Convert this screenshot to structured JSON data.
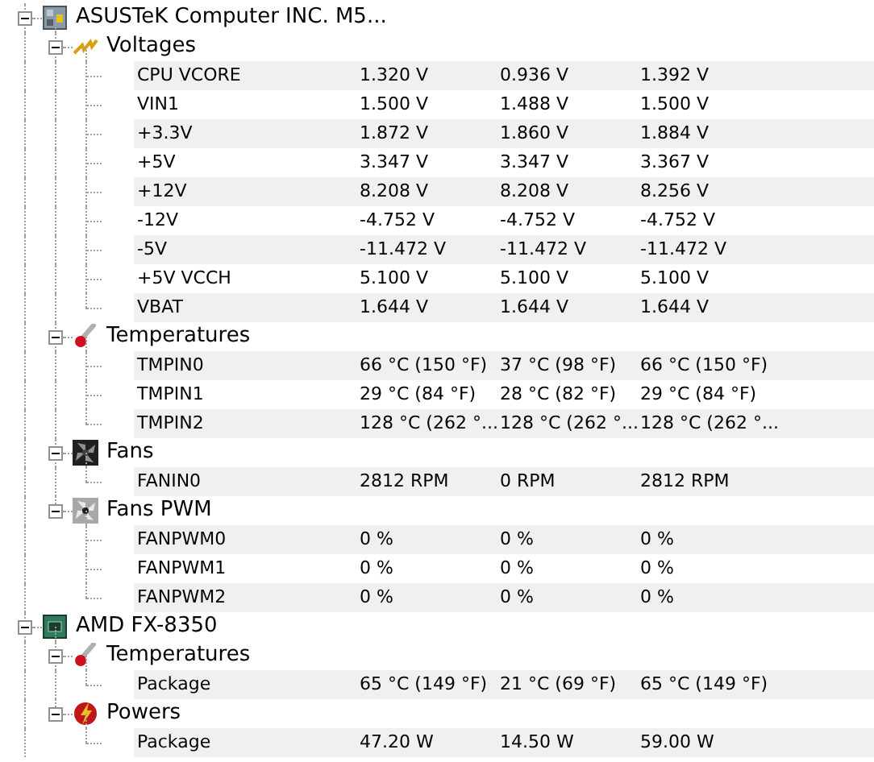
{
  "devices": [
    {
      "name": "ASUSTeK Computer INC. M5...",
      "kind": "motherboard",
      "expanded": true,
      "groups": [
        {
          "name": "Voltages",
          "kind": "voltage",
          "expanded": true,
          "rows": [
            {
              "name": "CPU VCORE",
              "values": [
                "1.320 V",
                "0.936 V",
                "1.392 V"
              ]
            },
            {
              "name": "VIN1",
              "values": [
                "1.500 V",
                "1.488 V",
                "1.500 V"
              ]
            },
            {
              "name": "+3.3V",
              "values": [
                "1.872 V",
                "1.860 V",
                "1.884 V"
              ]
            },
            {
              "name": "+5V",
              "values": [
                "3.347 V",
                "3.347 V",
                "3.367 V"
              ]
            },
            {
              "name": "+12V",
              "values": [
                "8.208 V",
                "8.208 V",
                "8.256 V"
              ]
            },
            {
              "name": "-12V",
              "values": [
                "-4.752 V",
                "-4.752 V",
                "-4.752 V"
              ]
            },
            {
              "name": "-5V",
              "values": [
                "-11.472 V",
                "-11.472 V",
                "-11.472 V"
              ]
            },
            {
              "name": "+5V VCCH",
              "values": [
                "5.100 V",
                "5.100 V",
                "5.100 V"
              ]
            },
            {
              "name": "VBAT",
              "values": [
                "1.644 V",
                "1.644 V",
                "1.644 V"
              ]
            }
          ]
        },
        {
          "name": "Temperatures",
          "kind": "temperature",
          "expanded": true,
          "rows": [
            {
              "name": "TMPIN0",
              "values": [
                "66 °C (150 °F)",
                "37 °C (98 °F)",
                "66 °C (150 °F)"
              ]
            },
            {
              "name": "TMPIN1",
              "values": [
                "29 °C (84 °F)",
                "28 °C (82 °F)",
                "29 °C (84 °F)"
              ]
            },
            {
              "name": "TMPIN2",
              "values": [
                "128 °C (262 °...",
                "128 °C (262 °...",
                "128 °C (262 °..."
              ]
            }
          ]
        },
        {
          "name": "Fans",
          "kind": "fan",
          "expanded": true,
          "rows": [
            {
              "name": "FANIN0",
              "values": [
                "2812 RPM",
                "0 RPM",
                "2812 RPM"
              ]
            }
          ]
        },
        {
          "name": "Fans PWM",
          "kind": "fanpwm",
          "expanded": true,
          "rows": [
            {
              "name": "FANPWM0",
              "values": [
                "0 %",
                "0 %",
                "0 %"
              ]
            },
            {
              "name": "FANPWM1",
              "values": [
                "0 %",
                "0 %",
                "0 %"
              ]
            },
            {
              "name": "FANPWM2",
              "values": [
                "0 %",
                "0 %",
                "0 %"
              ]
            }
          ]
        }
      ]
    },
    {
      "name": "AMD FX-8350",
      "kind": "cpu",
      "expanded": true,
      "groups": [
        {
          "name": "Temperatures",
          "kind": "temperature",
          "expanded": true,
          "rows": [
            {
              "name": "Package",
              "values": [
                "65 °C (149 °F)",
                "21 °C (69 °F)",
                "65 °C (149 °F)"
              ]
            }
          ]
        },
        {
          "name": "Powers",
          "kind": "power",
          "expanded": true,
          "rows": [
            {
              "name": "Package",
              "values": [
                "47.20 W",
                "14.50 W",
                "59.00 W"
              ]
            }
          ]
        }
      ]
    }
  ]
}
